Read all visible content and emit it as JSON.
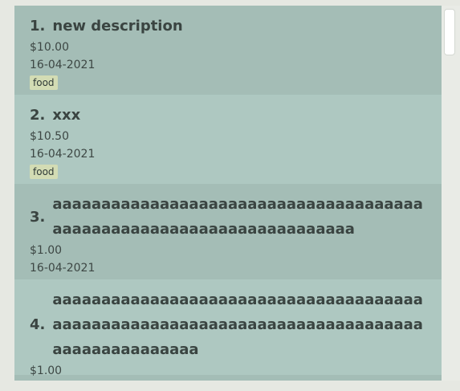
{
  "expenses": [
    {
      "index": "1.",
      "description": "new description",
      "amount": "$10.00",
      "date": "16-04-2021",
      "tag": "food"
    },
    {
      "index": "2.",
      "description": "xxx",
      "amount": "$10.50",
      "date": "16-04-2021",
      "tag": "food"
    },
    {
      "index": "3.",
      "description": "aaaaaaaaaaaaaaaaaaaaaaaaaaaaaaaaaaaaaaaaaaaaaaaaaaaaaaaaaaaaaaaaaaaaa",
      "amount": "$1.00",
      "date": "16-04-2021",
      "tag": ""
    },
    {
      "index": "4.",
      "description": "aaaaaaaaaaaaaaaaaaaaaaaaaaaaaaaaaaaaaaaaaaaaaaaaaaaaaaaaaaaaaaaaaaaaaaaaaaaaaaaaaaaaaaaaaaa",
      "amount": "$1.00",
      "date": "16-04-2021",
      "tag": ""
    }
  ],
  "colors": {
    "card_dark": "#a4bdb6",
    "card_light": "#aec8c1",
    "tag_bg": "#d3dcb4",
    "background": "#e6e8e2"
  }
}
